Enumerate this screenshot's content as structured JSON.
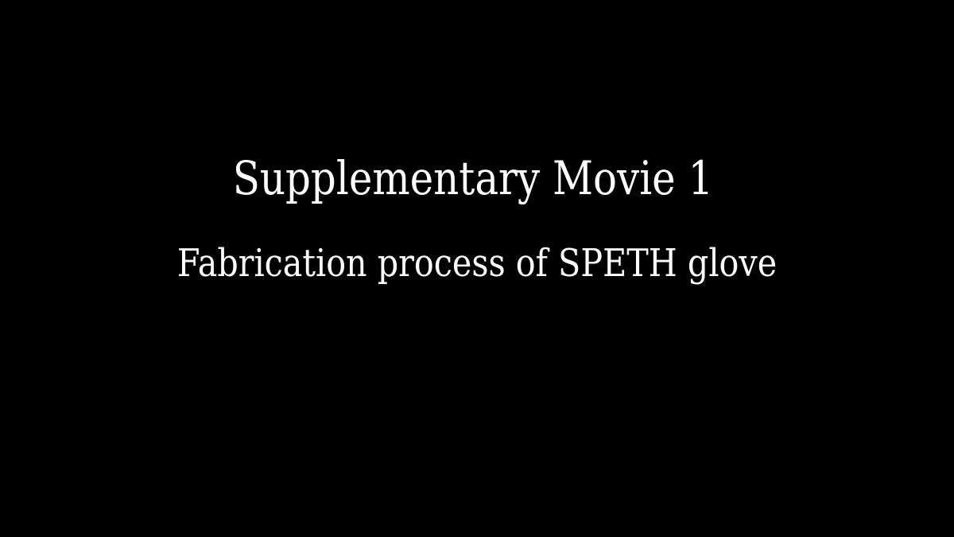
{
  "frame": {
    "title": "Supplementary Movie 1",
    "subtitle": "Fabrication process of SPETH glove",
    "background_color": "#000000",
    "text_color": "#ffffff"
  }
}
